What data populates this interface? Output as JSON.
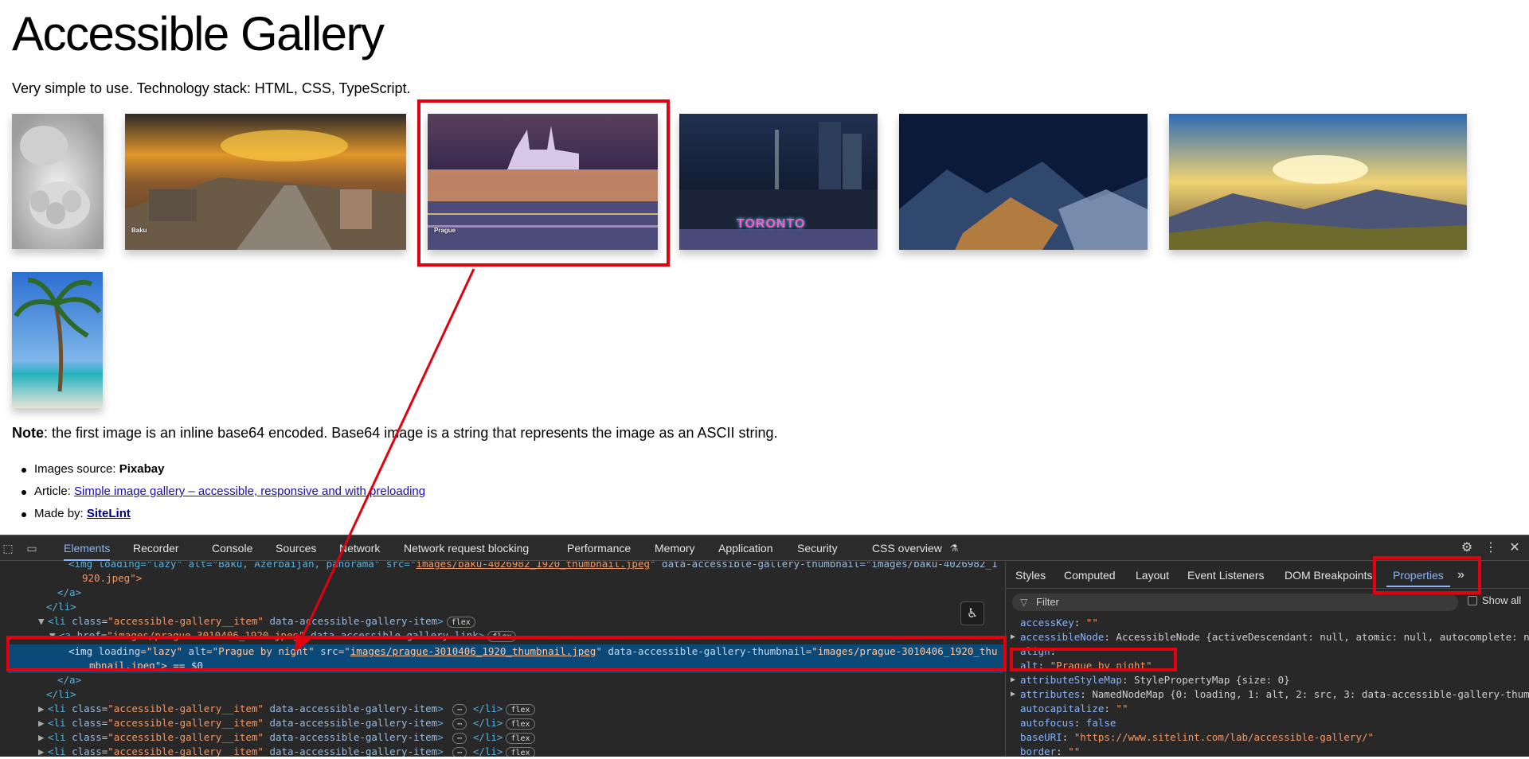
{
  "page": {
    "title": "Accessible Gallery",
    "intro": "Very simple to use. Technology stack: HTML, CSS, TypeScript.",
    "note_label": "Note",
    "note_text": ": the first image is an inline base64 encoded. Base64 image is a string that represents the image as an ASCII string.",
    "meta": {
      "source_label": "Images source: ",
      "source_value": "Pixabay",
      "article_label": "Article: ",
      "article_link": "Simple image gallery – accessible, responsive and with preloading",
      "madeby_label": "Made by: ",
      "madeby_link": "SiteLint"
    },
    "thumbs": [
      {
        "name": "thumb-hands",
        "caption": ""
      },
      {
        "name": "thumb-baku",
        "caption": "Baku"
      },
      {
        "name": "thumb-prague",
        "caption": "Prague"
      },
      {
        "name": "thumb-toronto",
        "caption": ""
      },
      {
        "name": "thumb-mountain-village",
        "caption": ""
      },
      {
        "name": "thumb-sunset-hills",
        "caption": ""
      },
      {
        "name": "thumb-palm-beach",
        "caption": ""
      }
    ],
    "toronto_sign": "TORONTO"
  },
  "devtools": {
    "tabs": [
      "Elements",
      "Recorder",
      "Console",
      "Sources",
      "Network",
      "Network request blocking",
      "Performance",
      "Memory",
      "Application",
      "Security",
      "CSS overview"
    ],
    "active_tab": "Elements",
    "elements": {
      "l0_a": "<img loading=\"lazy\" alt=\"Baku, Azerbaijan, panorama\" src=\"",
      "l0_link": "images/baku-4026982_1920_thumbnail.jpeg",
      "l0_b": "\" data-accessible-gallery-thumbnail=\"images/baku-4026982_1",
      "l1": "920.jpeg\">",
      "l2": "</a>",
      "l3": "</li>",
      "l4_tag": "<li ",
      "l4_attr": "class",
      "l4_val": "\"accessible-gallery__item\"",
      "l4_attr2": " data-accessible-gallery-item",
      "l4_end": ">",
      "l5_tag": "<a ",
      "l5_attr": "href",
      "l5_val": "\"images/prague-3010406_1920.jpeg\"",
      "l5_attr2": " data-accessible-gallery-link",
      "l5_end": ">",
      "sel_tag": "<img ",
      "sel_attr1": "loading",
      "sel_val1": "\"lazy\"",
      "sel_attr2": " alt",
      "sel_val2": "\"Prague by night\"",
      "sel_attr3": " src",
      "sel_link": "images/prague-3010406_1920_thumbnail.jpeg",
      "sel_attr4": " data-accessible-gallery-thumbnail",
      "sel_val4": "\"images/prague-3010406_1920_thu",
      "sel_l2": "mbnail.jpeg\">",
      "sel_eq": " == $0",
      "l8": "</a>",
      "l9": "</li>",
      "li_tag": "<li ",
      "li_attr": "class",
      "li_val": "\"accessible-gallery__item\"",
      "li_attr2": " data-accessible-gallery-item",
      "li_mid": "> ",
      "li_dots": "⋯",
      "li_close": " </li>",
      "flex": "flex"
    },
    "side_tabs": [
      "Styles",
      "Computed",
      "Layout",
      "Event Listeners",
      "DOM Breakpoints",
      "Properties"
    ],
    "active_side_tab": "Properties",
    "filter_placeholder": "Filter",
    "show_all": "Show all",
    "properties": [
      {
        "key": "accessKey",
        "value": "\"\"",
        "kind": "str"
      },
      {
        "key": "accessibleNode",
        "value": "AccessibleNode {activeDescendant: null, atomic: null, autocomplete: n",
        "kind": "obj"
      },
      {
        "key": "align",
        "value": "\"\"",
        "kind": "str"
      },
      {
        "key": "alt",
        "value": "\"Prague by night\"",
        "kind": "str"
      },
      {
        "key": "attributeStyleMap",
        "value": "StylePropertyMap {size: 0}",
        "kind": "obj"
      },
      {
        "key": "attributes",
        "value": "NamedNodeMap {0: loading, 1: alt, 2: src, 3: data-accessible-gallery-thum",
        "kind": "obj"
      },
      {
        "key": "autocapitalize",
        "value": "\"\"",
        "kind": "str"
      },
      {
        "key": "autofocus",
        "value": "false",
        "kind": "kw"
      },
      {
        "key": "baseURI",
        "value": "\"https://www.sitelint.com/lab/accessible-gallery/\"",
        "kind": "str"
      },
      {
        "key": "border",
        "value": "\"\"",
        "kind": "str"
      }
    ]
  }
}
